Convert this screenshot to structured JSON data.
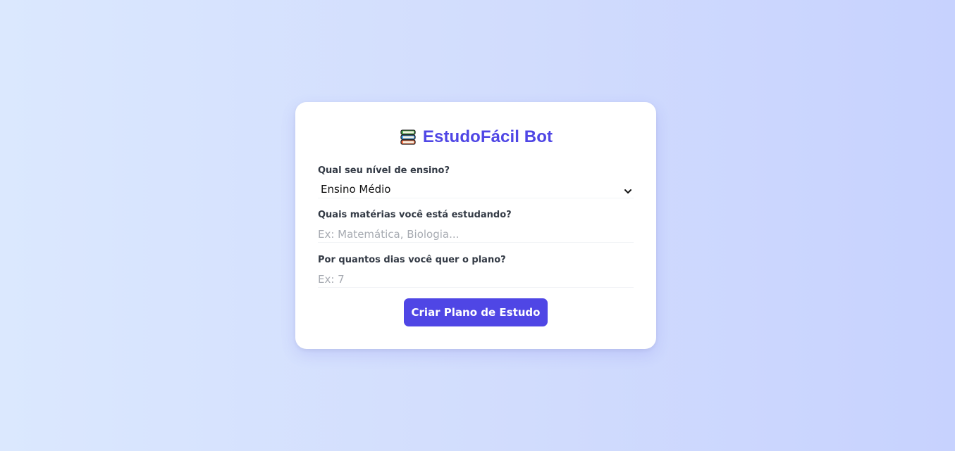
{
  "app": {
    "title": "EstudoFácil Bot",
    "icon": "books-icon"
  },
  "form": {
    "level": {
      "label": "Qual seu nível de ensino?",
      "selected": "Ensino Médio"
    },
    "subjects": {
      "label": "Quais matérias você está estudando?",
      "value": "",
      "placeholder": "Ex: Matemática, Biologia..."
    },
    "days": {
      "label": "Por quantos dias você quer o plano?",
      "value": "",
      "placeholder": "Ex: 7"
    },
    "submit_label": "Criar Plano de Estudo"
  },
  "colors": {
    "accent": "#4f46e5",
    "background_start": "#dbe8fe",
    "background_end": "#c7d2fe",
    "card": "#ffffff"
  }
}
